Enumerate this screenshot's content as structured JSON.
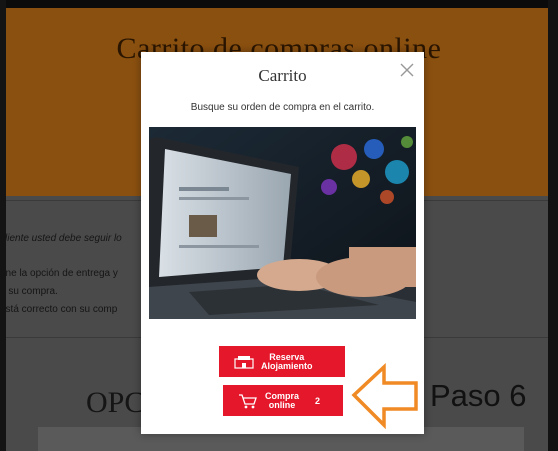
{
  "page": {
    "hero_title": "Carrito de compras online",
    "content_lines": [
      "cliente usted debe seguir lo",
      "one la opción de entrega y",
      "e su compra.",
      "está correcto con su comp"
    ],
    "section_title": "OPC"
  },
  "modal": {
    "title": "Carrito",
    "subtitle": "Busque su orden de compra en el carrito.",
    "image": "laptop-photo",
    "close_icon": "close-icon"
  },
  "buttons": {
    "reserva": {
      "label": "Reserva\nAlojamiento",
      "icon": "hotel-icon"
    },
    "compra": {
      "label": "Compra\nonline",
      "count": "2",
      "icon": "cart-icon"
    }
  },
  "annotation": {
    "step_label": "Paso 6",
    "arrow_color": "#f08a24"
  },
  "colors": {
    "accent_red": "#e5172b",
    "hero_overlay": "#8a5010"
  }
}
